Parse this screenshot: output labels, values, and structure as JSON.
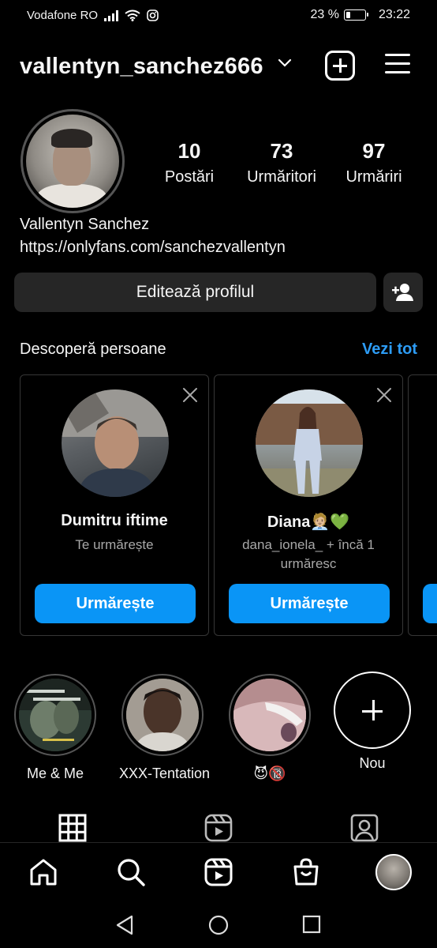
{
  "status_bar": {
    "carrier": "Vodafone RO",
    "battery_percent": "23 %",
    "battery_level": 0.23,
    "time": "23:22",
    "icons": [
      "signal-icon",
      "wifi-icon",
      "instagram-notification-icon",
      "battery-icon"
    ]
  },
  "header": {
    "username": "vallentyn_sanchez666",
    "icons": [
      "chevron-down-icon",
      "new-post-icon",
      "menu-icon"
    ]
  },
  "profile": {
    "stats": [
      {
        "value": "10",
        "label": "Postări"
      },
      {
        "value": "73",
        "label": "Urmăritori"
      },
      {
        "value": "97",
        "label": "Urmăriri"
      }
    ],
    "full_name": "Vallentyn Sanchez",
    "bio_link": "https://onlyfans.com/sanchezvallentyn",
    "edit_button": "Editează profilul"
  },
  "discover": {
    "title": "Descoperă persoane",
    "see_all": "Vezi tot",
    "cards": [
      {
        "name": "Dumitru iftime",
        "subtitle": "Te urmărește",
        "button": "Urmărește"
      },
      {
        "name": "Diana🧑🏼‍💼💚",
        "subtitle": "dana_ionela_ + încă 1 urmăresc",
        "button": "Urmărește"
      }
    ]
  },
  "highlights": [
    {
      "label": "Me & Me"
    },
    {
      "label": "XXX-Tentation"
    },
    {
      "label": "😈🔞"
    },
    {
      "label": "Nou"
    }
  ],
  "profile_tabs": [
    "grid-icon",
    "reels-icon",
    "tagged-icon"
  ],
  "bottom_nav": [
    "home-icon",
    "search-icon",
    "reels-icon",
    "shop-icon",
    "profile-avatar"
  ],
  "system_nav": [
    "back-icon",
    "home-circle-icon",
    "recents-icon"
  ]
}
